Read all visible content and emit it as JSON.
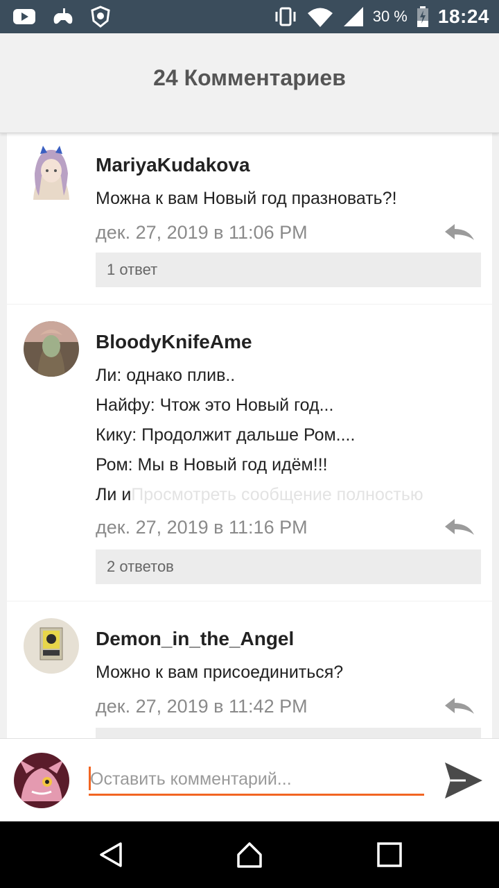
{
  "status_bar": {
    "left_icons": [
      "youtube-icon",
      "game-controller-icon",
      "shield-badge-icon"
    ],
    "right_icons": [
      "vibrate-icon",
      "wifi-icon",
      "signal-icon",
      "battery-icon"
    ],
    "battery": "30 %",
    "time": "18:24"
  },
  "header": {
    "title": "24 Комментариев"
  },
  "comments": [
    {
      "username": "MariyaKudakova",
      "lines": [
        "Можна к вам Новый год празновать?!"
      ],
      "date": "дек. 27, 2019 в 11:06 PM",
      "replies": "1 ответ"
    },
    {
      "username": "BloodyKnifeAme",
      "lines": [
        "Ли: однако плив..",
        "Найфу: Чтож это Новый год...",
        "Кику: Продолжит дальше Ром....",
        "Ром: Мы в Новый год идём!!!",
        "Ли и"
      ],
      "more_link": "Просмотреть сообщение полностью",
      "date": "дек. 27, 2019 в 11:16 PM",
      "replies": "2 ответов"
    },
    {
      "username": "Demon_in_the_Angel",
      "lines": [
        "Можно к вам присоединиться?"
      ],
      "date": "дек. 27, 2019 в 11:42 PM",
      "replies": ""
    }
  ],
  "composer": {
    "placeholder": "Оставить комментарий..."
  },
  "colors": {
    "accent": "#f26522",
    "status_bar": "#3b4d5c",
    "header_bg": "#f1f1f1"
  },
  "nav_icons": [
    "back-icon",
    "home-icon",
    "recents-icon"
  ]
}
